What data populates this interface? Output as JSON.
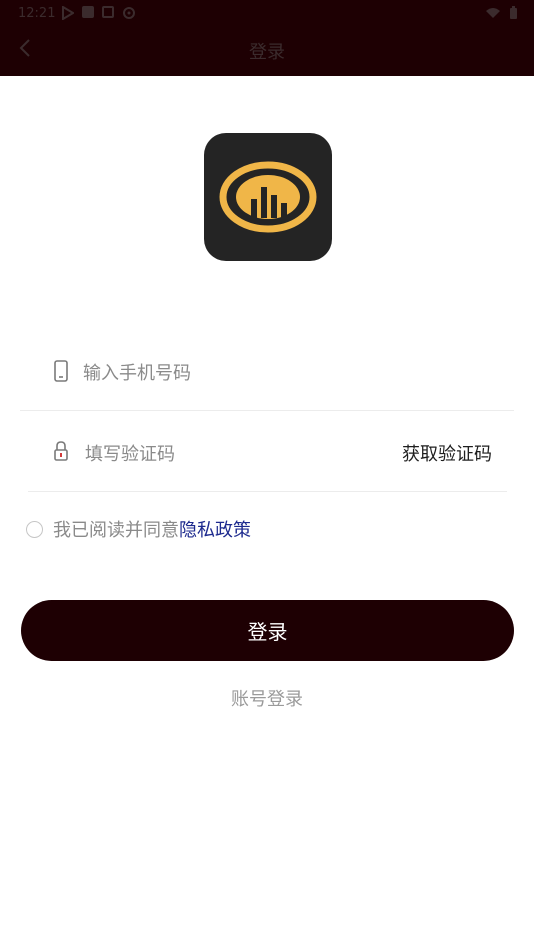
{
  "status_bar": {
    "time": "12:21",
    "left_icons": [
      "play-icon",
      "square-icon",
      "notification-icon",
      "settings-icon"
    ],
    "right_icons": [
      "wifi-icon",
      "battery-icon"
    ]
  },
  "header": {
    "title": "登录",
    "background": "#1e0003"
  },
  "form": {
    "phone_placeholder": "输入手机号码",
    "code_placeholder": "填写验证码",
    "get_code_label": "获取验证码"
  },
  "agreement": {
    "text": "我已阅读并同意",
    "link": "隐私政策",
    "link_color": "#1d2a8e"
  },
  "login_button": {
    "label": "登录"
  },
  "account_login_label": "账号登录",
  "logo": {
    "primary": "#242424",
    "accent": "#f0b648"
  }
}
